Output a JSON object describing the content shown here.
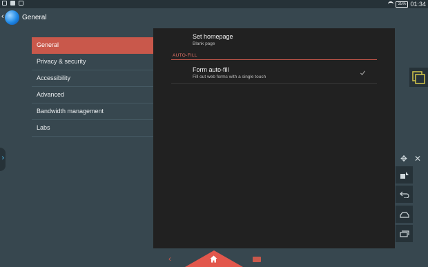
{
  "status_bar": {
    "battery": "35%",
    "time": "01:34"
  },
  "header": {
    "title": "General"
  },
  "menu": {
    "items": [
      {
        "label": "General",
        "active": true
      },
      {
        "label": "Privacy & security",
        "active": false
      },
      {
        "label": "Accessibility",
        "active": false
      },
      {
        "label": "Advanced",
        "active": false
      },
      {
        "label": "Bandwidth management",
        "active": false
      },
      {
        "label": "Labs",
        "active": false
      }
    ]
  },
  "detail": {
    "homepage": {
      "title": "Set homepage",
      "summary": "Blank page"
    },
    "section_label": "AUTO-FILL",
    "form_autofill": {
      "title": "Form auto-fill",
      "summary": "Fill out web forms with a single touch",
      "checked": true
    }
  },
  "colors": {
    "accent": "#c9584b",
    "background": "#37474f",
    "panel": "#212121"
  },
  "icons": [
    "back-chevron-icon",
    "browser-globe-icon",
    "checkmark-icon",
    "move-icon",
    "close-icon",
    "home-icon",
    "recent-apps-icon"
  ]
}
